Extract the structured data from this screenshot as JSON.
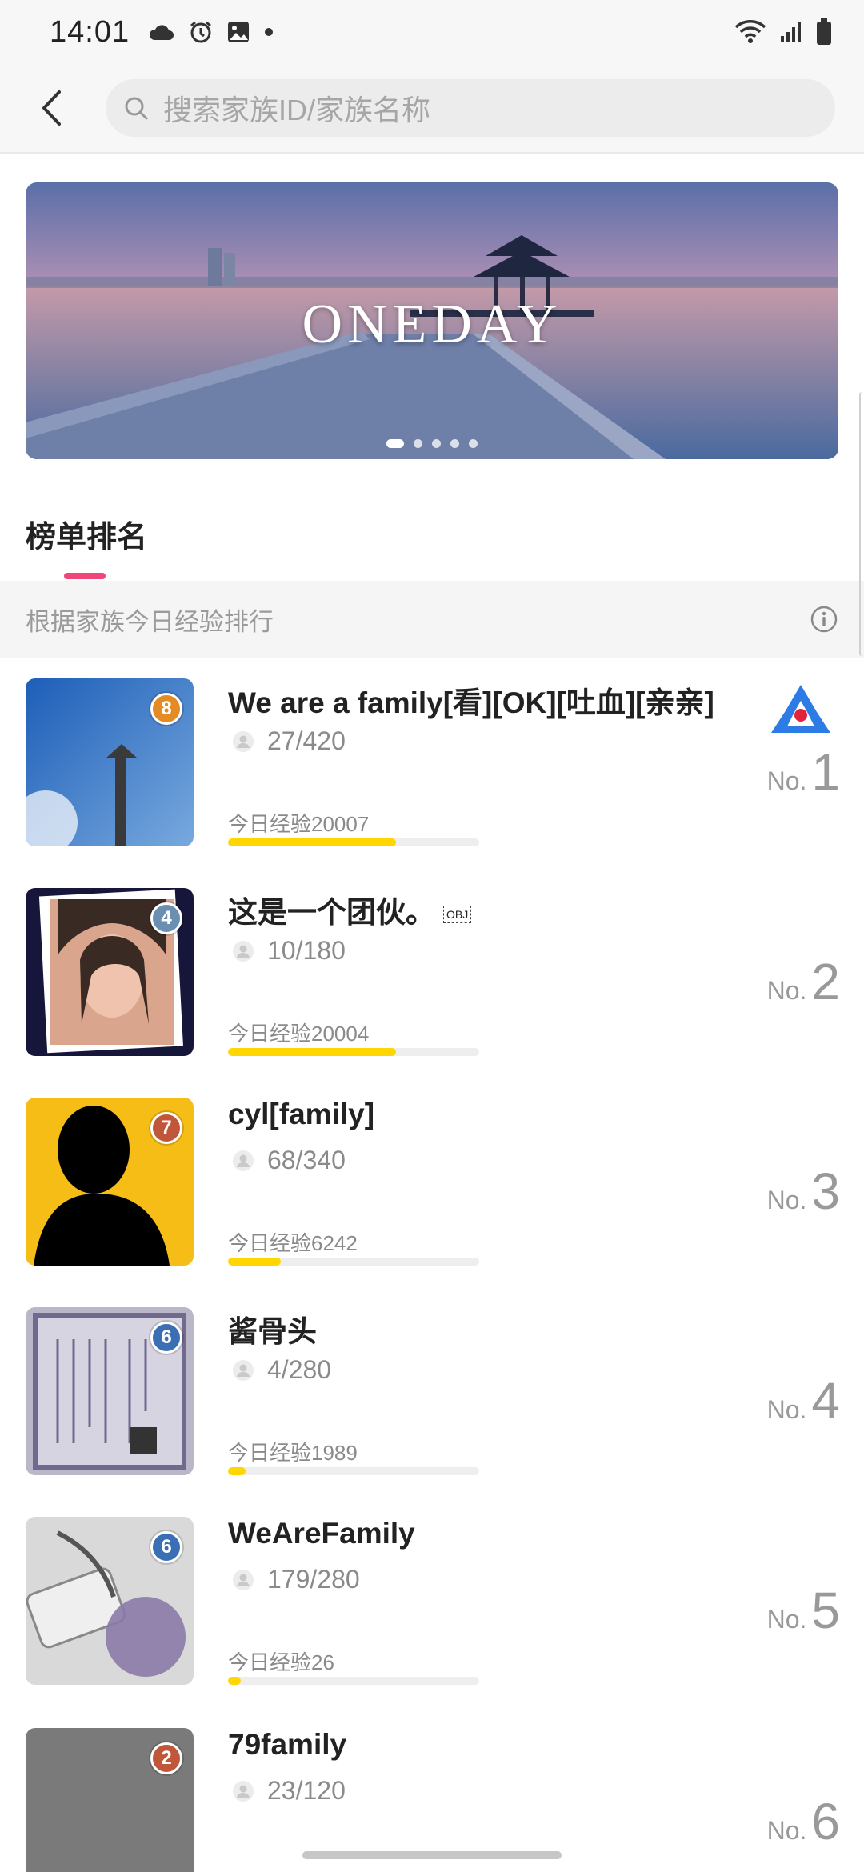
{
  "status_bar": {
    "time": "14:01",
    "left_icons": [
      "cloud-icon",
      "alarm-icon",
      "image-icon",
      "dot-icon"
    ],
    "right_icons": [
      "wifi-icon",
      "signal-icon",
      "battery-icon"
    ]
  },
  "header": {
    "search_placeholder": "搜索家族ID/家族名称"
  },
  "banner": {
    "title": "ONEDAY",
    "slide_count": 5,
    "active_slide": 1
  },
  "ranking": {
    "tab_label": "榜单排名",
    "info_text": "根据家族今日经验排行",
    "items": [
      {
        "name": "We are a family[看][OK][吐血][亲亲]",
        "level": "8",
        "members": "27/420",
        "exp_label": "今日经验20007",
        "exp_fraction": 0.67,
        "rank_prefix": "No.",
        "rank": "1",
        "badge_color": "#e58b25"
      },
      {
        "name": "这是一个团伙。",
        "name_suffix": "OBJ",
        "level": "4",
        "members": "10/180",
        "exp_label": "今日经验20004",
        "exp_fraction": 0.67,
        "rank_prefix": "No.",
        "rank": "2",
        "badge_color": "#6b8fb0"
      },
      {
        "name": "cyl[family]",
        "level": "7",
        "members": "68/340",
        "exp_label": "今日经验6242",
        "exp_fraction": 0.21,
        "rank_prefix": "No.",
        "rank": "3",
        "badge_color": "#c0563a"
      },
      {
        "name": "酱骨头",
        "level": "6",
        "members": "4/280",
        "exp_label": "今日经验1989",
        "exp_fraction": 0.07,
        "rank_prefix": "No.",
        "rank": "4",
        "badge_color": "#3a6fb5"
      },
      {
        "name": "WeAreFamily",
        "level": "6",
        "members": "179/280",
        "exp_label": "今日经验26",
        "exp_fraction": 0.05,
        "rank_prefix": "No.",
        "rank": "5",
        "badge_color": "#3a6fb5"
      },
      {
        "name": "79family",
        "level": "2",
        "members": "23/120",
        "exp_label": "",
        "exp_fraction": 0,
        "rank_prefix": "No.",
        "rank": "6",
        "badge_color": "#c0563a"
      }
    ]
  },
  "colors": {
    "accent": "#f0467a",
    "exp_bar": "#ffd600"
  }
}
